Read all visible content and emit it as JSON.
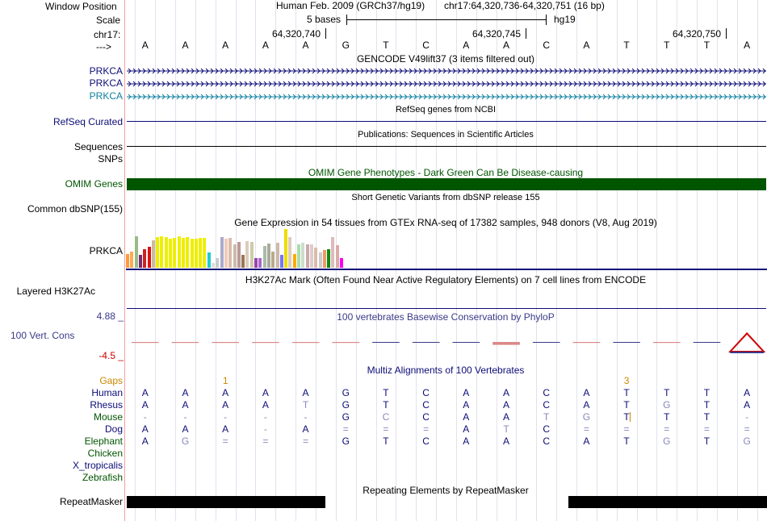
{
  "header": {
    "window_position_label": "Window Position",
    "scale_label": "Scale",
    "chrom_label": "chr17:",
    "strand_label": "--->",
    "assembly": "Human Feb. 2009 (GRCh37/hg19)",
    "position": "chr17:64,320,736-64,320,751 (16 bp)",
    "scale_text": "5 bases",
    "scale_db": "hg19",
    "ruler_ticks": [
      "64,320,740",
      "64,320,745",
      "64,320,750"
    ],
    "sequence": [
      "A",
      "A",
      "A",
      "A",
      "A",
      "G",
      "T",
      "C",
      "A",
      "A",
      "C",
      "A",
      "T",
      "T",
      "T",
      "A"
    ]
  },
  "tracks": {
    "gencode": {
      "title": "GENCODE V49lift37 (3 items filtered out)",
      "labels": [
        "PRKCA",
        "PRKCA",
        "PRKCA"
      ],
      "colors": [
        "#0c0c78",
        "#0c0c78",
        "#1080a0"
      ]
    },
    "refseq": {
      "title": "RefSeq genes from NCBI",
      "label": "RefSeq Curated",
      "color": "#0c0c78"
    },
    "publications": {
      "title": "Publications: Sequences in Scientific Articles",
      "labels": [
        "Sequences",
        "SNPs"
      ]
    },
    "omim": {
      "title": "OMIM Gene Phenotypes - Dark Green Can Be Disease-causing",
      "label": "OMIM Genes",
      "color": "#005500"
    },
    "dbsnp": {
      "title": "Short Genetic Variants from dbSNP release 155",
      "label": "Common dbSNP(155)"
    },
    "gtex": {
      "title": "Gene Expression in 54 tissues from GTEx RNA-seq of 17382 samples, 948 donors (V8, Aug 2019)",
      "label": "PRKCA",
      "bars": [
        {
          "h": 0.35,
          "c": "#ff9a3c"
        },
        {
          "h": 0.42,
          "c": "#ffaa55"
        },
        {
          "h": 0.82,
          "c": "#99bb88"
        },
        {
          "h": 0.34,
          "c": "#7a2a6a"
        },
        {
          "h": 0.48,
          "c": "#cc2222"
        },
        {
          "h": 0.55,
          "c": "#dd1111"
        },
        {
          "h": 0.7,
          "c": "#ccbb99"
        },
        {
          "h": 0.8,
          "c": "#eeee00"
        },
        {
          "h": 0.82,
          "c": "#eeee00"
        },
        {
          "h": 0.8,
          "c": "#eeee00"
        },
        {
          "h": 0.74,
          "c": "#eeee00"
        },
        {
          "h": 0.77,
          "c": "#eeee00"
        },
        {
          "h": 0.81,
          "c": "#eeee00"
        },
        {
          "h": 0.78,
          "c": "#eeee00"
        },
        {
          "h": 0.8,
          "c": "#eeee00"
        },
        {
          "h": 0.75,
          "c": "#eeee00"
        },
        {
          "h": 0.75,
          "c": "#eeee00"
        },
        {
          "h": 0.77,
          "c": "#eeee00"
        },
        {
          "h": 0.77,
          "c": "#eeee00"
        },
        {
          "h": 0.39,
          "c": "#22cccc"
        },
        {
          "h": 0.12,
          "c": "#dddddd"
        },
        {
          "h": 0.25,
          "c": "#cccccc"
        },
        {
          "h": 0.8,
          "c": "#aaaacc"
        },
        {
          "h": 0.75,
          "c": "#eeccbb"
        },
        {
          "h": 0.78,
          "c": "#ddbbaa"
        },
        {
          "h": 0.61,
          "c": "#ccbbaa"
        },
        {
          "h": 0.67,
          "c": "#bb9999"
        },
        {
          "h": 0.34,
          "c": "#997755"
        },
        {
          "h": 0.68,
          "c": "#ddccbb"
        },
        {
          "h": 0.66,
          "c": "#ccccaa"
        },
        {
          "h": 0.26,
          "c": "#9944aa"
        },
        {
          "h": 0.24,
          "c": "#aa66cc"
        },
        {
          "h": 0.57,
          "c": "#aabbaa"
        },
        {
          "h": 0.62,
          "c": "#aaaa99"
        },
        {
          "h": 0.41,
          "c": "#bbaa88"
        },
        {
          "h": 0.65,
          "c": "#ccbbaa"
        },
        {
          "h": 0.34,
          "c": "#7777ee"
        },
        {
          "h": 1.0,
          "c": "#eedd00"
        },
        {
          "h": 0.79,
          "c": "#ddccbb"
        },
        {
          "h": 0.36,
          "c": "#ffaa00"
        },
        {
          "h": 0.6,
          "c": "#aaddaa"
        },
        {
          "h": 0.64,
          "c": "#ccddcc"
        },
        {
          "h": 0.61,
          "c": "#ccaaaa"
        },
        {
          "h": 0.61,
          "c": "#ddcccc"
        },
        {
          "h": 0.52,
          "c": "#ddbbaa"
        },
        {
          "h": 0.4,
          "c": "#cccccc"
        },
        {
          "h": 0.46,
          "c": "#ee9966"
        },
        {
          "h": 0.48,
          "c": "#118811"
        },
        {
          "h": 0.79,
          "c": "#ddbbbb"
        },
        {
          "h": 0.58,
          "c": "#ddaaaa"
        },
        {
          "h": 0.24,
          "c": "#ff00ee"
        }
      ]
    },
    "h3k27ac": {
      "title": "H3K27Ac Mark (Often Found Near Active Regulatory Elements) on 7 cell lines from ENCODE",
      "label": "Layered H3K27Ac"
    },
    "phylop": {
      "title": "100 vertebrates Basewise Conservation by PhyloP",
      "label": "100 Vert. Cons",
      "max": "4.88 _",
      "min": "-4.5 _",
      "color": "#3a3a88",
      "scores": [
        -0.2,
        -0.2,
        -0.2,
        -0.2,
        -0.2,
        -0.2,
        0.0,
        0.0,
        0.0,
        -0.6,
        0.0,
        -0.2,
        0.0,
        -0.2,
        0.0,
        2.8
      ]
    },
    "multiz": {
      "title": "Multiz Alignments of 100 Vertebrates",
      "gaps_label": "Gaps",
      "gap_marks": [
        {
          "pos": 2.5,
          "text": "1"
        },
        {
          "pos": 12.5,
          "text": "3"
        }
      ],
      "species": [
        {
          "name": "Human",
          "color": "#0c0c78",
          "bases": [
            "A",
            "A",
            "A",
            "A",
            "A",
            "G",
            "T",
            "C",
            "A",
            "A",
            "C",
            "A",
            "T",
            "T",
            "T",
            "A"
          ]
        },
        {
          "name": "Rhesus",
          "color": "#0c0c78",
          "bases": [
            "A",
            "A",
            "A",
            "A",
            "T",
            "G",
            "T",
            "C",
            "A",
            "A",
            "C",
            "A",
            "T",
            "G",
            "T",
            "A"
          ]
        },
        {
          "name": "Mouse",
          "color": "#005500",
          "bases": [
            "-",
            "-",
            "-",
            "-",
            "-",
            "G",
            "C",
            "C",
            "A",
            "A",
            "T",
            "G",
            "T",
            "T",
            "T",
            "-"
          ]
        },
        {
          "name": "Dog",
          "color": "#0c0c78",
          "bases": [
            "A",
            "A",
            "A",
            "-",
            "A",
            "=",
            "=",
            "=",
            "A",
            "T",
            "C",
            "=",
            "=",
            "=",
            "=",
            "="
          ]
        },
        {
          "name": "Elephant",
          "color": "#005500",
          "bases": [
            "A",
            "G",
            "=",
            "=",
            "=",
            "G",
            "T",
            "C",
            "A",
            "A",
            "C",
            "A",
            "T",
            "G",
            "T",
            "G"
          ]
        },
        {
          "name": "Chicken",
          "color": "#005500",
          "bases": []
        },
        {
          "name": "X_tropicalis",
          "color": "#0c0c78",
          "bases": []
        },
        {
          "name": "Zebrafish",
          "color": "#005500",
          "bases": []
        }
      ],
      "mismatch_color": "#8888bb"
    },
    "repeatmasker": {
      "title": "Repeating Elements by RepeatMasker",
      "label": "RepeatMasker",
      "blocks": [
        {
          "start": 0,
          "end": 5
        },
        {
          "start": 11,
          "end": 16
        }
      ]
    }
  },
  "colors": {
    "label_blue": "#0c0c78",
    "gap_orange": "#cc8800",
    "omim_green": "#005500",
    "phylop_red": "#cc0000",
    "divider": "#f0a0a0"
  }
}
